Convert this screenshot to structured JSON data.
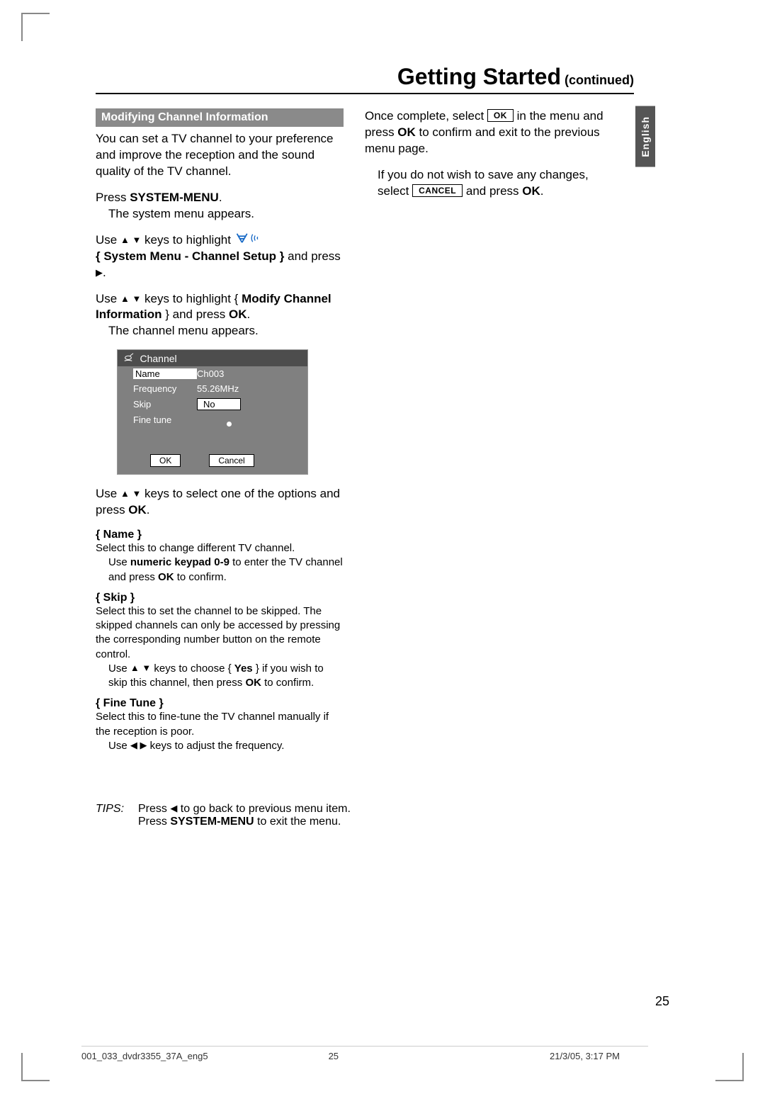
{
  "header": {
    "title_main": "Getting Started",
    "title_sub": " (continued)"
  },
  "lang_tab": "English",
  "left": {
    "section_title": "Modifying Channel Information",
    "intro": "You can set a TV channel to your preference and improve the reception and the sound quality of the TV channel.",
    "step1_a": "Press ",
    "step1_b": "SYSTEM-MENU",
    "step1_c": ".",
    "step1_res": "The system menu appears.",
    "step2_a": "Use ",
    "step2_b": " keys to highlight ",
    "step2_menu": "{ System Menu - Channel Setup }",
    "step2_c": " and press ",
    "step3_a": "Use ",
    "step3_b": " keys to highlight { ",
    "step3_bold": "Modify Channel Information",
    "step3_c": " } and press ",
    "step3_ok": "OK",
    "step3_d": ".",
    "step3_res": "The channel menu appears.",
    "channel_box": {
      "title": "Channel",
      "rows": {
        "name_label": "Name",
        "name_val": "Ch003",
        "freq_label": "Frequency",
        "freq_val": "55.26MHz",
        "skip_label": "Skip",
        "skip_val": "No",
        "ft_label": "Fine tune"
      },
      "ok_btn": "OK",
      "cancel_btn": "Cancel"
    },
    "step4_a": "Use ",
    "step4_b": " keys to select one of the options and press ",
    "step4_ok": "OK",
    "step4_c": ".",
    "opt_name_title": "{ Name }",
    "opt_name_1": "Select this to change different TV channel.",
    "opt_name_2a": "Use ",
    "opt_name_2b": "numeric keypad 0-9",
    "opt_name_2c": " to enter the TV channel and press ",
    "opt_name_2ok": "OK",
    "opt_name_2d": " to confirm.",
    "opt_skip_title": "{ Skip }",
    "opt_skip_1": "Select this to set the channel to be skipped. The skipped channels can only be accessed by pressing the corresponding number button on the remote control.",
    "opt_skip_2a": "Use ",
    "opt_skip_2b": " keys to choose { ",
    "opt_skip_yes": "Yes",
    "opt_skip_2c": " } if you wish to skip this channel, then press ",
    "opt_skip_ok": "OK",
    "opt_skip_2d": " to confirm.",
    "opt_ft_title": "{ Fine Tune }",
    "opt_ft_1": "Select this to fine-tune the TV channel manually if the reception is poor.",
    "opt_ft_2a": "Use ",
    "opt_ft_2b": " keys to adjust the frequency."
  },
  "right": {
    "p1_a": "Once complete, select ",
    "p1_ok_btn": "OK",
    "p1_b": " in the menu and press ",
    "p1_ok": "OK",
    "p1_c": " to confirm and exit to the previous menu page.",
    "p2_a": "If you do not wish to save any changes, select ",
    "p2_cancel_btn": "CANCEL",
    "p2_b": " and press ",
    "p2_ok": "OK",
    "p2_c": "."
  },
  "tips": {
    "label": "TIPS:",
    "line1_a": "Press ",
    "line1_b": " to go back to previous menu item.",
    "line2_a": "Press ",
    "line2_b": "SYSTEM-MENU",
    "line2_c": " to exit the menu."
  },
  "page_num": "25",
  "footer": {
    "f1": "001_033_dvdr3355_37A_eng5",
    "f2": "25",
    "f3": "21/3/05, 3:17 PM"
  }
}
